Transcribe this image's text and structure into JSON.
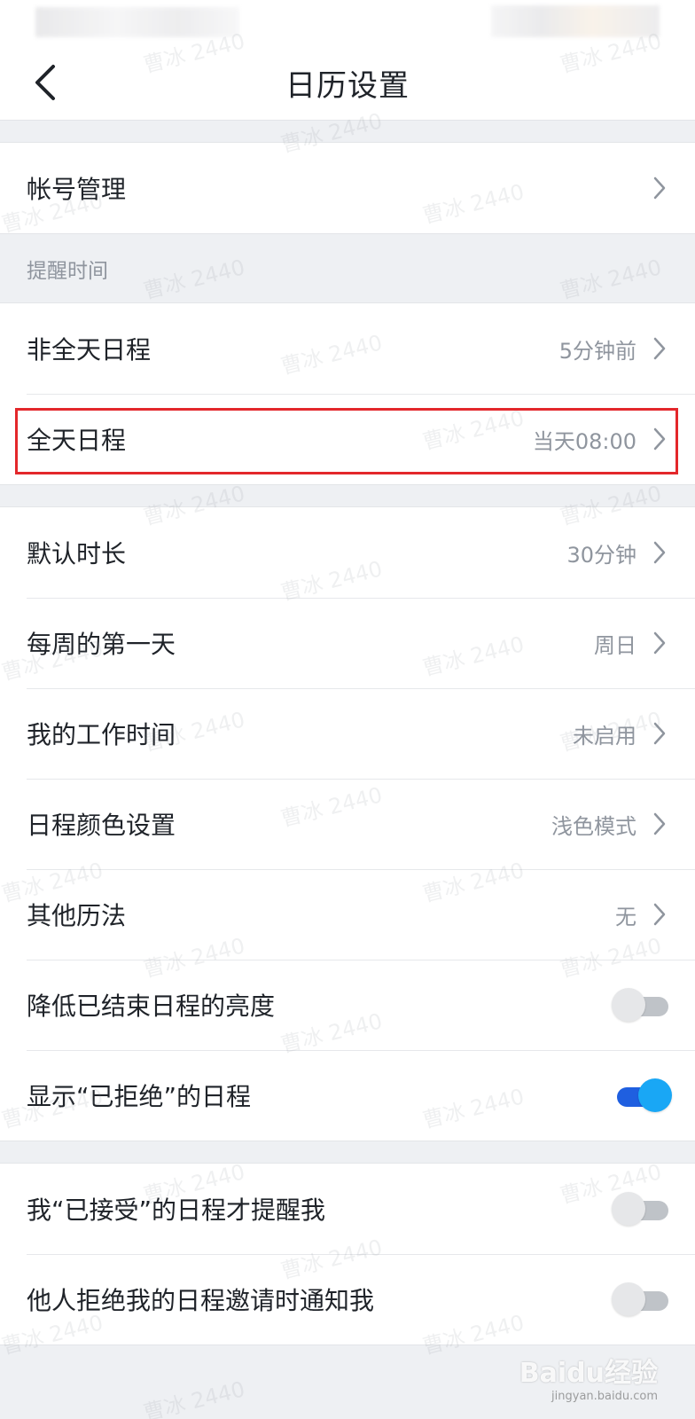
{
  "header": {
    "title": "日历设置"
  },
  "account": {
    "label": "帐号管理"
  },
  "reminder_section": {
    "title": "提醒时间",
    "items": [
      {
        "label": "非全天日程",
        "value": "5分钟前"
      },
      {
        "label": "全天日程",
        "value": "当天08:00"
      }
    ]
  },
  "general": {
    "items": [
      {
        "label": "默认时长",
        "value": "30分钟"
      },
      {
        "label": "每周的第一天",
        "value": "周日"
      },
      {
        "label": "我的工作时间",
        "value": "未启用"
      },
      {
        "label": "日程颜色设置",
        "value": "浅色模式"
      },
      {
        "label": "其他历法",
        "value": "无"
      }
    ],
    "toggles": [
      {
        "label": "降低已结束日程的亮度",
        "on": false
      },
      {
        "label": "显示“已拒绝”的日程",
        "on": true
      }
    ]
  },
  "notify": {
    "toggles": [
      {
        "label": "我“已接受”的日程才提醒我",
        "on": false
      },
      {
        "label": "他人拒绝我的日程邀请时通知我",
        "on": false
      }
    ]
  },
  "watermark_text": "曹冰 2440",
  "branding": {
    "logo": "Baidu经验",
    "site": "jingyan.baidu.com"
  },
  "colors": {
    "accent": "#1f5fe0",
    "highlight": "#e3272b"
  }
}
